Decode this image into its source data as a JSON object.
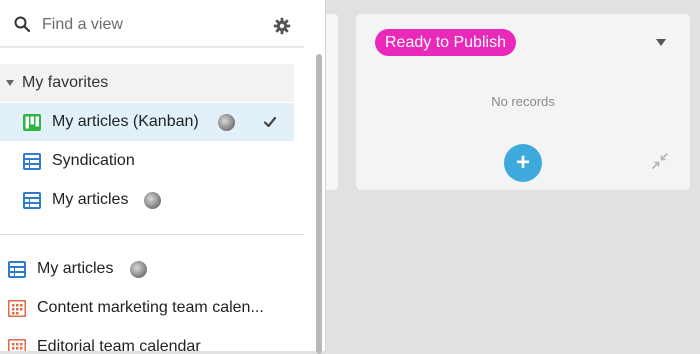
{
  "search": {
    "placeholder": "Find a view",
    "value": ""
  },
  "sidebar": {
    "section": {
      "label": "My favorites"
    },
    "favorites": [
      {
        "label": "My articles (Kanban)",
        "icon": "kanban-icon",
        "selected": true,
        "shared_avatar": true,
        "checked": true
      },
      {
        "label": "Syndication",
        "icon": "grid-icon",
        "selected": false,
        "shared_avatar": false
      },
      {
        "label": "My articles",
        "icon": "grid-icon",
        "selected": false,
        "shared_avatar": true
      }
    ],
    "views": [
      {
        "label": "My articles",
        "icon": "grid-icon",
        "shared_avatar": true
      },
      {
        "label": "Content marketing team calen...",
        "icon": "calendar-icon",
        "shared_avatar": false
      },
      {
        "label": "Editorial team calendar",
        "icon": "calendar-icon",
        "shared_avatar": false
      }
    ]
  },
  "kanban": {
    "stack": {
      "label": "Ready to Publish",
      "empty_text": "No records",
      "add_label": "+",
      "badge_color": "#e929ba"
    }
  },
  "colors": {
    "accent": "#3da9dc",
    "kanban_icon": "#2fb344",
    "grid_icon": "#2e7bcf",
    "calendar_icon": "#e06c45",
    "selected_row": "#e1f0f9"
  }
}
